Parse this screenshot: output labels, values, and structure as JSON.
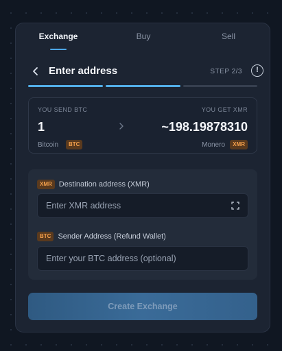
{
  "tabs": [
    {
      "label": "Exchange",
      "active": true
    },
    {
      "label": "Buy",
      "active": false
    },
    {
      "label": "Sell",
      "active": false
    }
  ],
  "header": {
    "title": "Enter address",
    "step": "STEP 2/3",
    "info_glyph": "!"
  },
  "progress": {
    "current_step": 2,
    "total_steps": 3
  },
  "summary": {
    "send_label": "YOU SEND BTC",
    "send_amount": "1",
    "send_coin": "Bitcoin",
    "send_ticker": "BTC",
    "get_label": "YOU GET XMR",
    "get_amount": "~198.19878310",
    "get_coin": "Monero",
    "get_ticker": "XMR"
  },
  "form": {
    "destination": {
      "badge": "XMR",
      "label": "Destination address (XMR)",
      "placeholder": "Enter XMR address"
    },
    "refund": {
      "badge": "BTC",
      "label": "Sender Address (Refund Wallet)",
      "placeholder": "Enter your BTC address (optional)"
    }
  },
  "create_button": {
    "label": "Create Exchange",
    "enabled": false
  },
  "colors": {
    "accent": "#52aee8",
    "badge_bg": "#5a3a1e",
    "badge_text": "#f4a04c",
    "card_bg": "#1c2432"
  },
  "icons": {
    "back": "chevron-left-icon",
    "info": "info-icon",
    "arrow": "arrow-right-icon",
    "scan": "scan-qr-icon"
  }
}
